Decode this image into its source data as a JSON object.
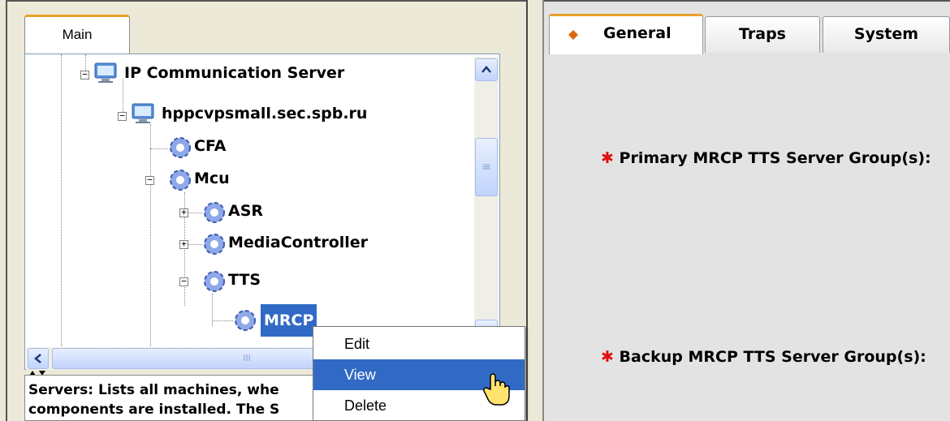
{
  "left_panel": {
    "tab_label": "Main",
    "tree": {
      "root": "IP Communication Server",
      "host": "hppcvpsmall.sec.spb.ru",
      "nodes": [
        "CFA",
        "Mcu",
        "ASR",
        "MediaController",
        "TTS",
        "MRCP"
      ]
    },
    "info_text_line1": "Servers: Lists all machines, whe",
    "info_text_line2": "components are installed. The S",
    "hscroll_grip": "III",
    "vscroll_grip": "≡"
  },
  "context_menu": {
    "items": [
      "Edit",
      "View",
      "Delete"
    ],
    "highlighted": "View"
  },
  "right_panel": {
    "tabs": [
      "General",
      "Traps",
      "System"
    ],
    "active_tab": "General",
    "fields": {
      "primary_label": "Primary MRCP TTS Server Group(s):",
      "backup_label": "Backup MRCP TTS Server Group(s):",
      "required_marker": "✱"
    }
  },
  "icons": {
    "active_tab_marker": "diamond-icon",
    "tree_server": "computer-icon",
    "tree_component": "gear-icon",
    "cursor": "hand-cursor-icon"
  },
  "colors": {
    "selection": "#316AC5",
    "tab_accent": "#E8A02C",
    "required": "#E01010"
  }
}
